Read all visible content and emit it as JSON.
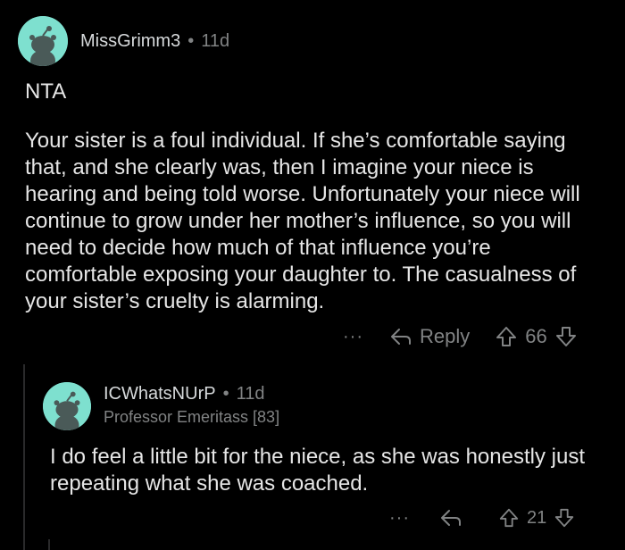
{
  "comment1": {
    "username": "MissGrimm3",
    "separator": "•",
    "time": "11d",
    "verdict": "NTA",
    "body": "Your sister is a foul individual. If she’s comfortable saying that, and she clearly was, then I imagine your niece is hearing and being told worse. Unfortunately your niece will continue to grow under her mother’s influence, so you will need to decide how much of that influence you’re comfortable exposing your daughter to. The casualness of your sister’s cruelty is alarming.",
    "more_label": "···",
    "reply_label": "Reply",
    "vote_count": "66"
  },
  "comment2": {
    "username": "ICWhatsNUrP",
    "separator": "•",
    "time": "11d",
    "flair": "Professor Emeritass [83]",
    "body": "I do feel a little bit for the niece, as she was honestly just repeating what she was coached.",
    "more_label": "···",
    "vote_count": "21"
  },
  "colors": {
    "background": "#000000",
    "avatar": "#7ee0cf",
    "meta": "#818384",
    "text": "#e6e6e6"
  }
}
